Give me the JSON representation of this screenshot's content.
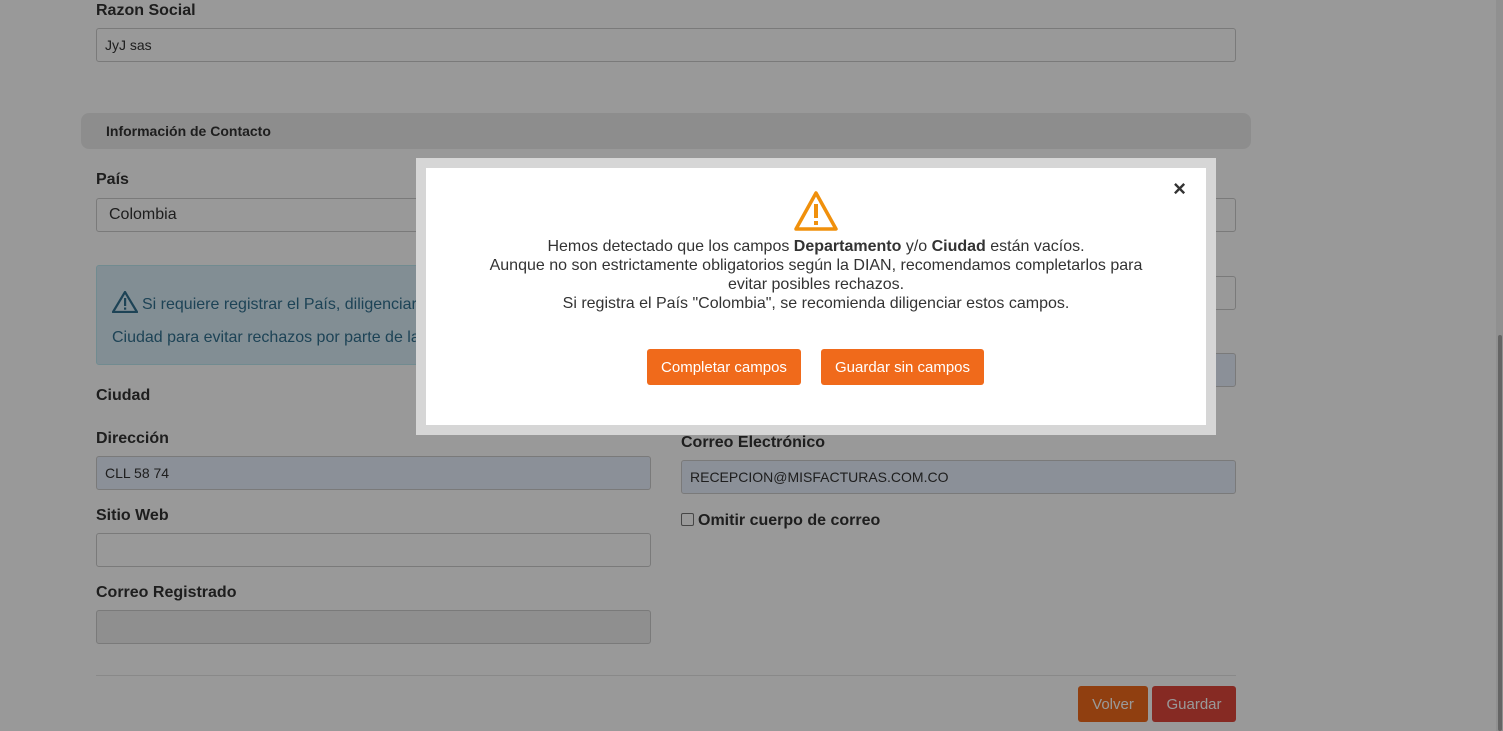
{
  "form": {
    "razon_social": {
      "label": "Razon Social",
      "value": "JyJ sas"
    },
    "section_title": "Información de Contacto",
    "pais": {
      "label": "País",
      "value": "Colombia"
    },
    "alert": {
      "line1": "Si requiere registrar el País, diligenciar l",
      "line2": "Ciudad para evitar rechazos por parte de la"
    },
    "ciudad": {
      "label": "Ciudad"
    },
    "direccion": {
      "label": "Dirección",
      "value": "CLL 58 74"
    },
    "sitio_web": {
      "label": "Sitio Web",
      "value": ""
    },
    "correo_registrado": {
      "label": "Correo Registrado",
      "value": ""
    },
    "correo_electronico": {
      "label": "Correo Electrónico",
      "value": "RECEPCION@MISFACTURAS.COM.CO"
    },
    "omitir": {
      "label": "Omitir cuerpo de correo",
      "checked": false
    }
  },
  "actions": {
    "volver": "Volver",
    "guardar": "Guardar"
  },
  "modal": {
    "close": "×",
    "line1_pre": "Hemos detectado que los campos ",
    "line1_b1": "Departamento",
    "line1_mid": " y/o ",
    "line1_b2": "Ciudad",
    "line1_post": " están vacíos.",
    "line2": "Aunque no son estrictamente obligatorios según la DIAN, recomendamos completarlos para",
    "line3": "evitar posibles rechazos.",
    "line4": "Si registra el País \"Colombia\", se recomienda diligenciar estos campos.",
    "btn_completar": "Completar campos",
    "btn_guardar_sin": "Guardar sin campos",
    "icon": "warning-triangle-icon"
  },
  "colors": {
    "accent": "#f06a1b",
    "danger": "#e0463b",
    "warning_icon": "#f0900c"
  }
}
